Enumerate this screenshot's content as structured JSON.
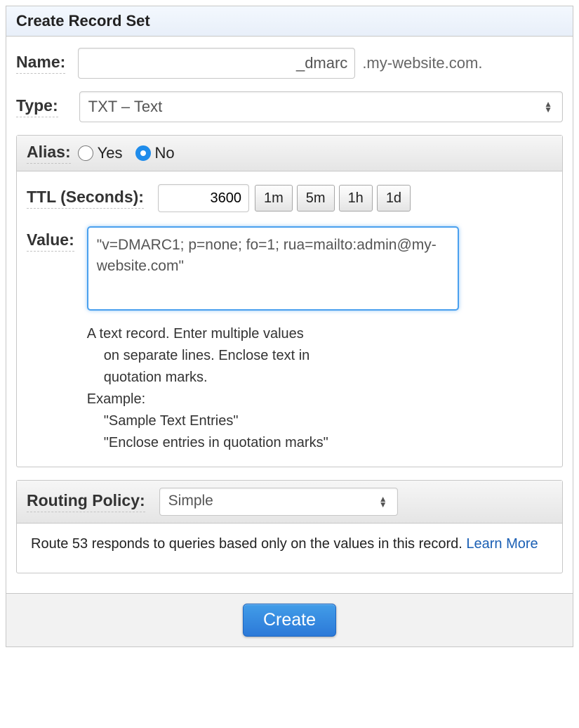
{
  "header": {
    "title": "Create Record Set"
  },
  "name": {
    "label": "Name:",
    "value": "_dmarc",
    "suffix": ".my-website.com."
  },
  "type": {
    "label": "Type:",
    "selected": "TXT – Text"
  },
  "alias": {
    "label": "Alias:",
    "yes_label": "Yes",
    "no_label": "No",
    "selected": "no"
  },
  "ttl": {
    "label": "TTL (Seconds):",
    "value": "3600",
    "buttons": [
      "1m",
      "5m",
      "1h",
      "1d"
    ]
  },
  "value": {
    "label": "Value:",
    "text": "\"v=DMARC1; p=none; fo=1; rua=mailto:admin@my-website.com\"",
    "help_line1": "A text record. Enter multiple values",
    "help_line2": "on separate lines. Enclose text in",
    "help_line3": "quotation marks.",
    "help_example_label": "Example:",
    "help_example1": "\"Sample Text Entries\"",
    "help_example2": "\"Enclose entries in quotation marks\""
  },
  "routing": {
    "label": "Routing Policy:",
    "selected": "Simple",
    "description": "Route 53 responds to queries based only on the values in this record.  ",
    "learn_more": "Learn More"
  },
  "footer": {
    "create_label": "Create"
  }
}
